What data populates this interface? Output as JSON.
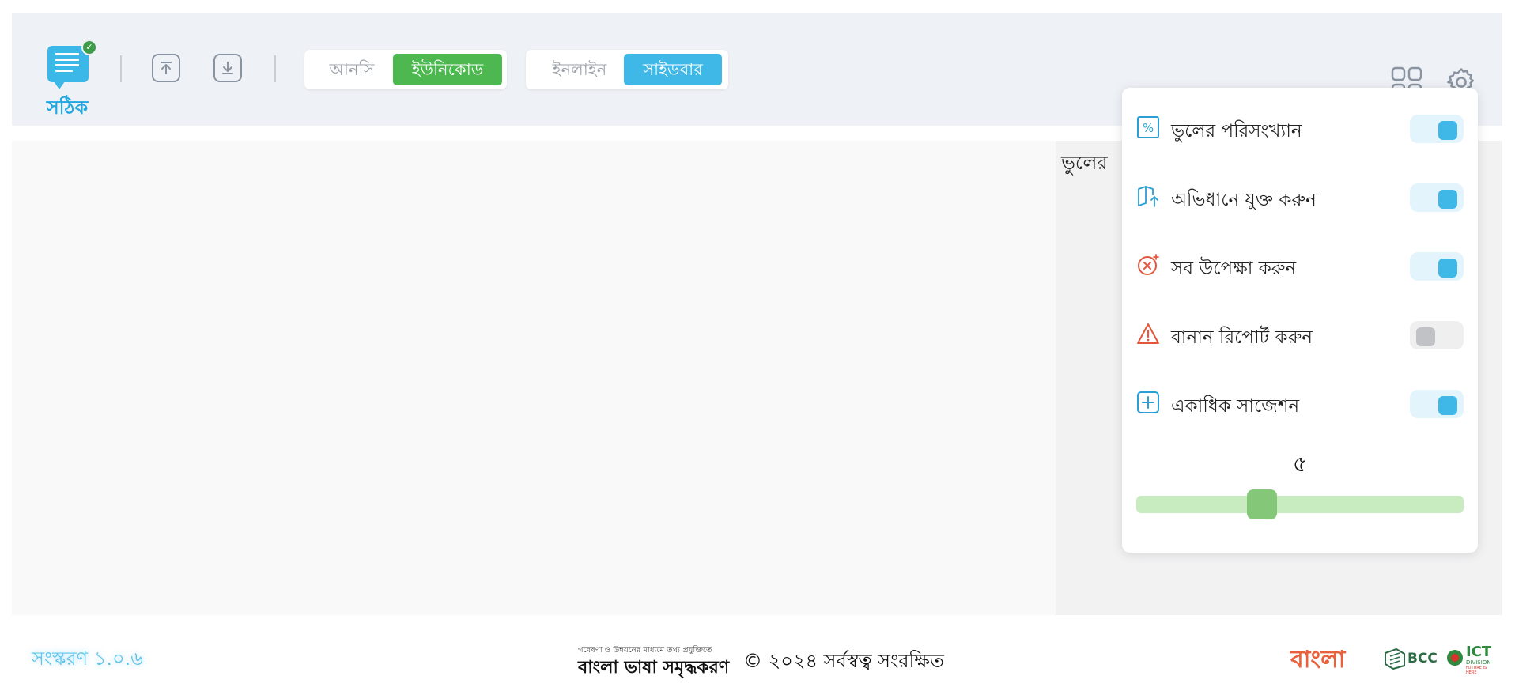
{
  "app": {
    "logo_text": "সঠিক"
  },
  "toolbar": {
    "encoding": {
      "options": [
        "আনসি",
        "ইউনিকোড"
      ],
      "selected": "ইউনিকোড"
    },
    "view": {
      "options": [
        "ইনলাইন",
        "সাইডবার"
      ],
      "selected": "সাইডবার"
    }
  },
  "sidebar": {
    "title": "ভুলের"
  },
  "settings_panel": {
    "items": [
      {
        "label": "ভুলের পরিসংখ্যান",
        "icon": "percent-icon",
        "enabled": true
      },
      {
        "label": "অভিধানে যুক্ত করুন",
        "icon": "book-add-icon",
        "enabled": true
      },
      {
        "label": "সব উপেক্ষা করুন",
        "icon": "ignore-all-icon",
        "enabled": true
      },
      {
        "label": "বানান রিপোর্ট করুন",
        "icon": "warning-icon",
        "enabled": false
      },
      {
        "label": "একাধিক সাজেশন",
        "icon": "plus-square-icon",
        "enabled": true
      }
    ],
    "suggestion_count": "৫"
  },
  "footer": {
    "version": "সংস্করণ ১.০.৬",
    "credit_small": "গবেষণা ও উন্নয়নের মাধ্যমে তথ্য প্রযুক্তিতে",
    "credit_big": "বাংলা ভাষা সমৃদ্ধকরণ",
    "copyright": "© ২০২৪ সর্বস্বত্ব সংরক্ষিত",
    "brands": {
      "bangla": "বাংলা",
      "bcc": "BCC",
      "ict": "ICT",
      "ict_sub": "DIVISION",
      "ict_tag": "FUTURE IS HERE"
    }
  },
  "colors": {
    "accent_blue": "#3fb8e8",
    "accent_green": "#4cb84f",
    "header_bg": "#eef2f7",
    "slider_green": "#84c778"
  }
}
